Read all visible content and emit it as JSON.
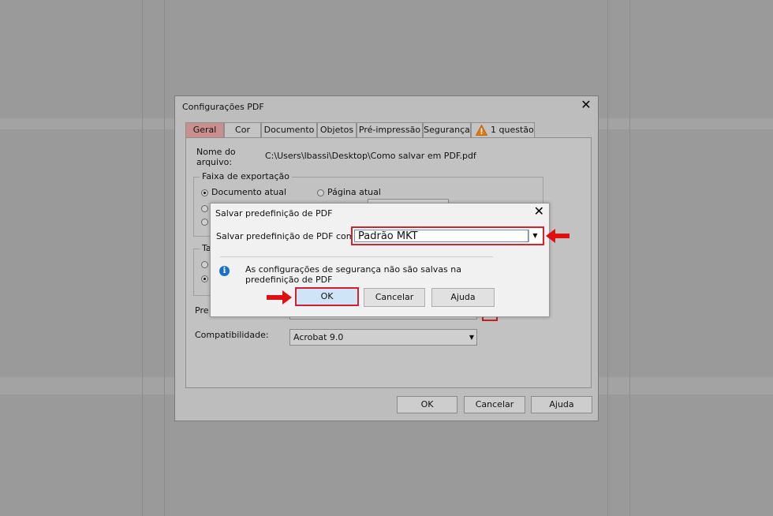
{
  "main_dialog": {
    "title": "Configurações PDF",
    "close_glyph": "✕",
    "tabs": [
      "Geral",
      "Cor",
      "Documento",
      "Objetos",
      "Pré-impressão",
      "Segurança",
      "1 questão"
    ],
    "file_label_line1": "Nome do",
    "file_label_line2": "arquivo:",
    "file_path": "C:\\Users\\lbassi\\Desktop\\Como salvar em PDF.pdf",
    "export_range_title": "Faixa de exportação",
    "option_current_doc": "Documento atual",
    "option_current_page": "Página atual",
    "group2_title_partial": "Ta",
    "preset_label_partial": "Pre",
    "compat_label": "Compatibilidade:",
    "compat_value": "Acrobat 9.0",
    "buttons": {
      "ok": "OK",
      "cancel": "Cancelar",
      "help": "Ajuda"
    }
  },
  "modal": {
    "title": "Salvar predefinição de PDF",
    "close_glyph": "✕",
    "field_label": "Salvar predefinição de PDF como:",
    "field_value": "Padrão MKT",
    "info_glyph": "i",
    "message_line1": "As configurações de segurança não são salvas na",
    "message_line2": "predefinição de PDF",
    "buttons": {
      "ok": "OK",
      "cancel": "Cancelar",
      "help": "Ajuda"
    }
  },
  "glyphs": {
    "dropdown": "▼",
    "warning": "!"
  },
  "colors": {
    "highlight_red": "#e02020",
    "active_tab": "#c98f8f",
    "info_blue": "#1a6fc9",
    "ok_fill": "#cfe4f7"
  }
}
